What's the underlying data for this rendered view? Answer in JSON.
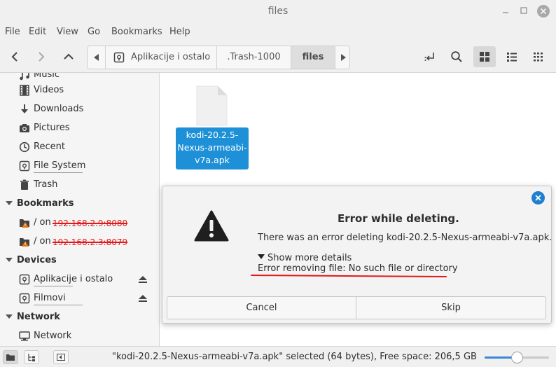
{
  "window": {
    "title": "files"
  },
  "menubar": [
    "File",
    "Edit",
    "View",
    "Go",
    "Bookmarks",
    "Help"
  ],
  "pathbar": {
    "segments": [
      "Aplikacije i ostalo",
      ".Trash-1000",
      "files"
    ]
  },
  "sidebar": {
    "places": [
      "Music",
      "Videos",
      "Downloads",
      "Pictures",
      "Recent",
      "File System",
      "Trash"
    ],
    "bookmarks_header": "Bookmarks",
    "bookmarks": [
      {
        "prefix": "/ on",
        "host": "192.168.2.9:8080"
      },
      {
        "prefix": "/ on",
        "host": "192.168.2.3:8079"
      }
    ],
    "devices_header": "Devices",
    "devices": [
      "Aplikacije i ostalo",
      "Filmovi"
    ],
    "network_header": "Network",
    "network": [
      "Network"
    ]
  },
  "file": {
    "name_lines": [
      "kodi-20.2.5-",
      "Nexus-armeabi-",
      "v7a.apk"
    ]
  },
  "dialog": {
    "title": "Error while deleting.",
    "message": "There was an error deleting kodi-20.2.5-Nexus-armeabi-v7a.apk.",
    "details_toggle": "Show more details",
    "error_detail": "Error removing file: No such file or directory",
    "cancel_label": "Cancel",
    "skip_label": "Skip"
  },
  "statusbar": {
    "text": "\"kodi-20.2.5-Nexus-armeabi-v7a.apk\" selected (64 bytes), Free space: 206,5 GB",
    "zoom_level": 0.5
  },
  "colors": {
    "accent": "#1e90d8",
    "annotation": "#e01919"
  }
}
